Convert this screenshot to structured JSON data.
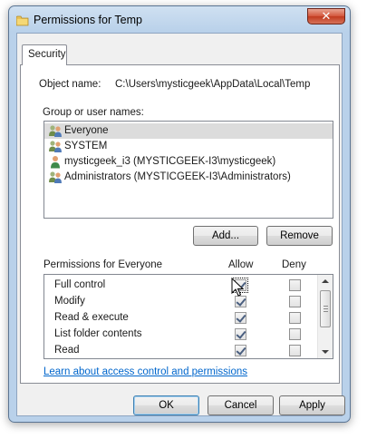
{
  "window": {
    "title": "Permissions for Temp",
    "close_symbol": "✕"
  },
  "tab": {
    "label": "Security"
  },
  "object": {
    "label": "Object name:",
    "value": "C:\\Users\\mysticgeek\\AppData\\Local\\Temp"
  },
  "groups": {
    "label": "Group or user names:",
    "items": [
      {
        "name": "Everyone",
        "icon": "group-icon",
        "selected": true
      },
      {
        "name": "SYSTEM",
        "icon": "group-icon",
        "selected": false
      },
      {
        "name": "mysticgeek_i3 (MYSTICGEEK-I3\\mysticgeek)",
        "icon": "user-icon",
        "selected": false
      },
      {
        "name": "Administrators (MYSTICGEEK-I3\\Administrators)",
        "icon": "group-icon",
        "selected": false
      }
    ]
  },
  "buttons": {
    "add": "Add...",
    "remove": "Remove",
    "ok": "OK",
    "cancel": "Cancel",
    "apply": "Apply"
  },
  "permissions": {
    "label": "Permissions for Everyone",
    "allow_header": "Allow",
    "deny_header": "Deny",
    "rows": [
      {
        "name": "Full control",
        "allow": true,
        "deny": false
      },
      {
        "name": "Modify",
        "allow": true,
        "deny": false
      },
      {
        "name": "Read & execute",
        "allow": true,
        "deny": false
      },
      {
        "name": "List folder contents",
        "allow": true,
        "deny": false
      },
      {
        "name": "Read",
        "allow": true,
        "deny": false
      }
    ]
  },
  "link": {
    "text": "Learn about access control and permissions"
  },
  "colors": {
    "link": "#0066cc",
    "titlebar": "#b9d1ea",
    "close": "#c13a1f"
  }
}
